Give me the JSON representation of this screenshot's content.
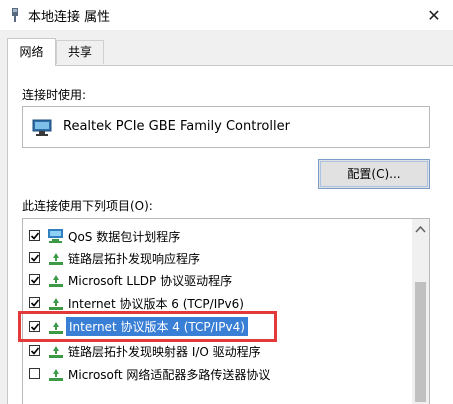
{
  "window": {
    "title": "本地连接 属性",
    "close_glyph": "✕"
  },
  "tabs": [
    {
      "label": "网络"
    },
    {
      "label": "共享"
    }
  ],
  "connect_using_label": "连接时使用:",
  "adapter": {
    "name": "Realtek PCIe GBE Family Controller"
  },
  "configure_button": "配置(C)...",
  "items_label": "此连接使用下列项目(O):",
  "items": [
    {
      "label": "QoS 数据包计划程序",
      "checked": true,
      "icon": "qos-icon"
    },
    {
      "label": "链路层拓扑发现响应程序",
      "checked": true,
      "icon": "protocol-icon"
    },
    {
      "label": "Microsoft LLDP 协议驱动程序",
      "checked": true,
      "icon": "protocol-icon"
    },
    {
      "label": "Internet 协议版本 6 (TCP/IPv6)",
      "checked": true,
      "icon": "protocol-icon"
    },
    {
      "label": "Internet 协议版本 4 (TCP/IPv4)",
      "checked": true,
      "icon": "protocol-icon",
      "selected": true
    },
    {
      "label": "链路层拓扑发现映射器 I/O 驱动程序",
      "checked": true,
      "icon": "protocol-icon"
    },
    {
      "label": "Microsoft 网络适配器多路传送器协议",
      "checked": false,
      "icon": "protocol-icon"
    }
  ],
  "colors": {
    "selection": "#3a7fd6",
    "highlight_border": "#e23a3a",
    "protocol_icon": "#3c9a47"
  }
}
